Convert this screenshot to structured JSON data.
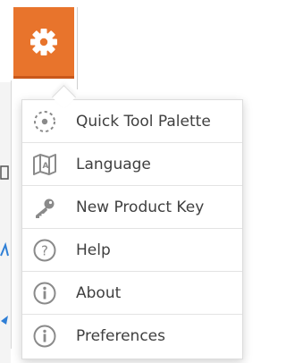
{
  "toolbar": {
    "settings_icon": "gear-icon",
    "accent_color": "#e8742c"
  },
  "menu": {
    "items": [
      {
        "label": "Quick Tool Palette",
        "icon": "quick-tool-palette-icon"
      },
      {
        "label": "Language",
        "icon": "language-map-icon"
      },
      {
        "label": "New Product Key",
        "icon": "key-icon"
      },
      {
        "label": "Help",
        "icon": "help-icon"
      },
      {
        "label": "About",
        "icon": "info-icon"
      },
      {
        "label": "Preferences",
        "icon": "info-icon"
      }
    ]
  }
}
